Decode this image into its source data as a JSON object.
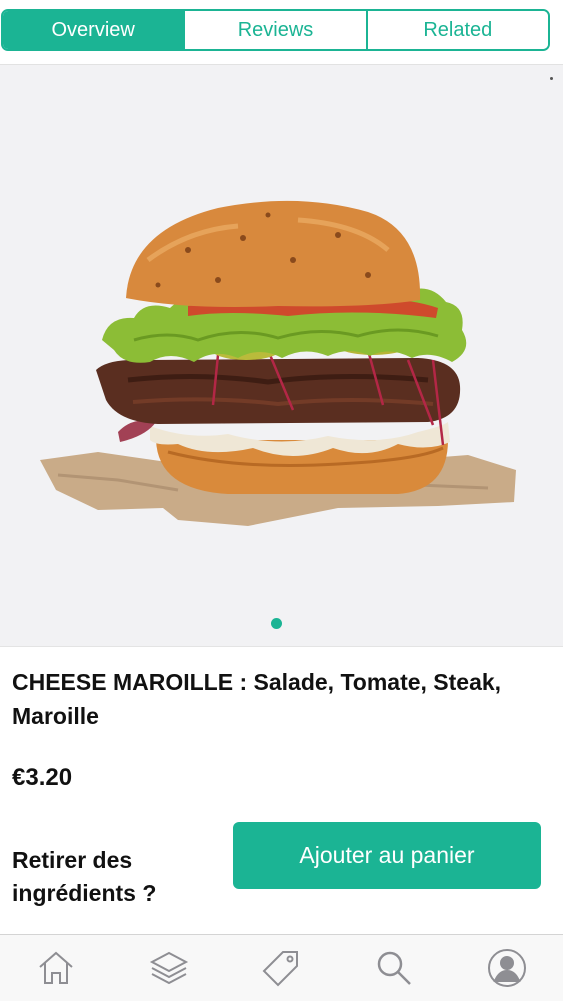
{
  "tabs": [
    {
      "label": "Overview",
      "active": true
    },
    {
      "label": "Reviews",
      "active": false
    },
    {
      "label": "Related",
      "active": false
    }
  ],
  "gallery": {
    "image": "burger-photo",
    "current_page": 1,
    "page_count": 1
  },
  "product": {
    "title": "CHEESE MAROILLE : Salade, Tomate, Steak, Maroille",
    "price": "€3.20",
    "remove_ingredients": "Retirer des ingrédients ?",
    "add_to_cart": "Ajouter au panier"
  },
  "tabbar": {
    "icons": [
      "home-icon",
      "layers-icon",
      "tag-icon",
      "search-icon",
      "user-icon"
    ]
  },
  "colors": {
    "accent": "#1bb494",
    "text": "#111111",
    "gallery_bg": "#f2f2f4"
  }
}
